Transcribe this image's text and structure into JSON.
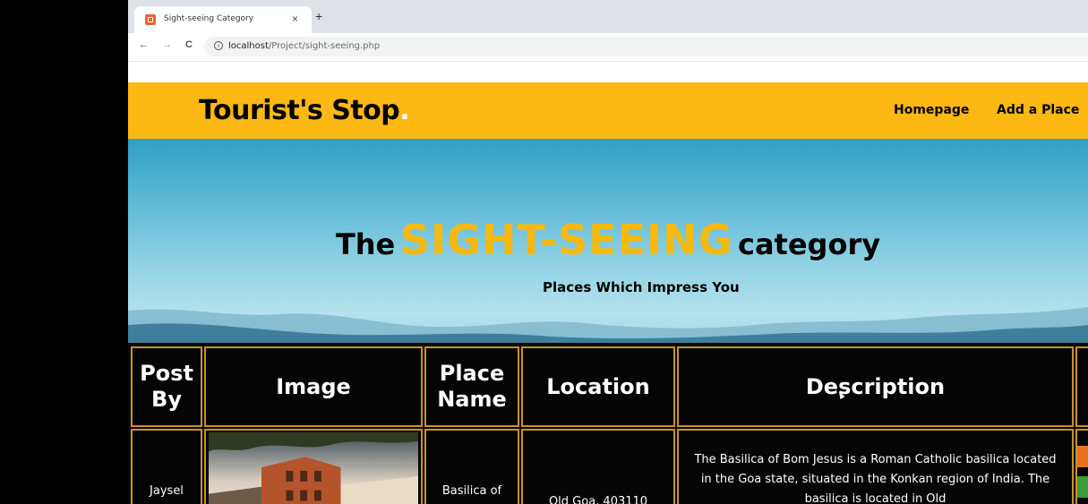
{
  "browser": {
    "tab": {
      "title": "Sight-seeing Category",
      "close": "×"
    },
    "new_tab": "+",
    "nav": {
      "back": "←",
      "forward": "→",
      "reload": "C"
    },
    "url": {
      "host": "localhost",
      "path": "/Project/sight-seeing.php"
    }
  },
  "site": {
    "logo": {
      "text": "Tourist's Stop",
      "dot": "."
    },
    "nav": [
      {
        "label": "Homepage"
      },
      {
        "label": "Add a Place"
      }
    ]
  },
  "hero": {
    "title_prefix": "The",
    "title_highlight": "SIGHT-SEEING",
    "title_suffix": "category",
    "subtitle": "Places Which Impress You"
  },
  "table": {
    "headers": {
      "post_by": [
        "Post",
        "By"
      ],
      "image": "Image",
      "place_name": [
        "Place",
        "Name"
      ],
      "location": "Location",
      "description": "Description"
    },
    "rows": [
      {
        "post_by": "Jaysel",
        "place_name": "Basilica of",
        "location": "Old Goa, 403110",
        "description": "The Basilica of Bom Jesus is a Roman Catholic basilica located in the Goa state, situated in the Konkan region of India. The basilica is located in Old"
      }
    ]
  },
  "colors": {
    "accent": "#fdb813",
    "border": "#c8902c",
    "table_bg": "#050505"
  }
}
